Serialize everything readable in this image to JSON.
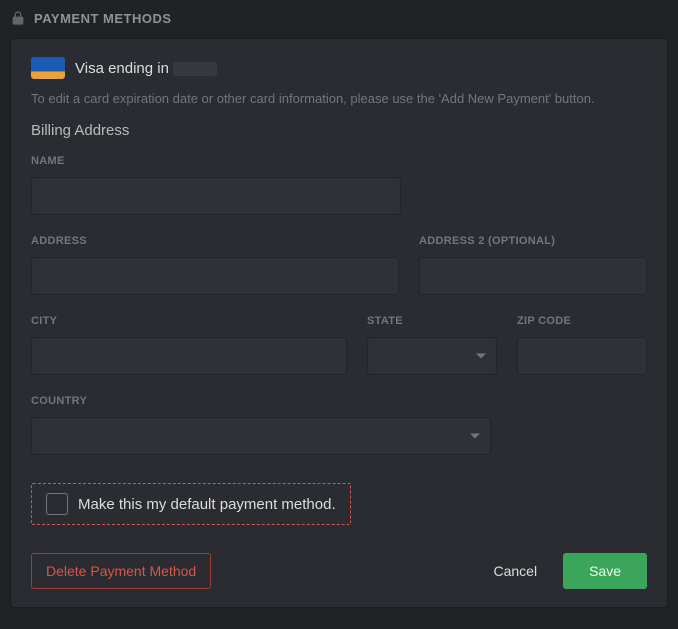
{
  "header": {
    "title": "PAYMENT METHODS"
  },
  "card": {
    "brand_label": "Visa ending in",
    "helper_text": "To edit a card expiration date or other card information, please use the 'Add New Payment' button."
  },
  "billing": {
    "section_title": "Billing Address",
    "name_label": "NAME",
    "address_label": "ADDRESS",
    "address2_label": "ADDRESS 2 (OPTIONAL)",
    "city_label": "CITY",
    "state_label": "STATE",
    "zip_label": "ZIP CODE",
    "country_label": "COUNTRY",
    "name_value": "",
    "address_value": "",
    "address2_value": "",
    "city_value": "",
    "state_value": "",
    "zip_value": "",
    "country_value": ""
  },
  "default_payment": {
    "label": "Make this my default payment method.",
    "checked": false
  },
  "buttons": {
    "delete": "Delete Payment Method",
    "cancel": "Cancel",
    "save": "Save"
  }
}
